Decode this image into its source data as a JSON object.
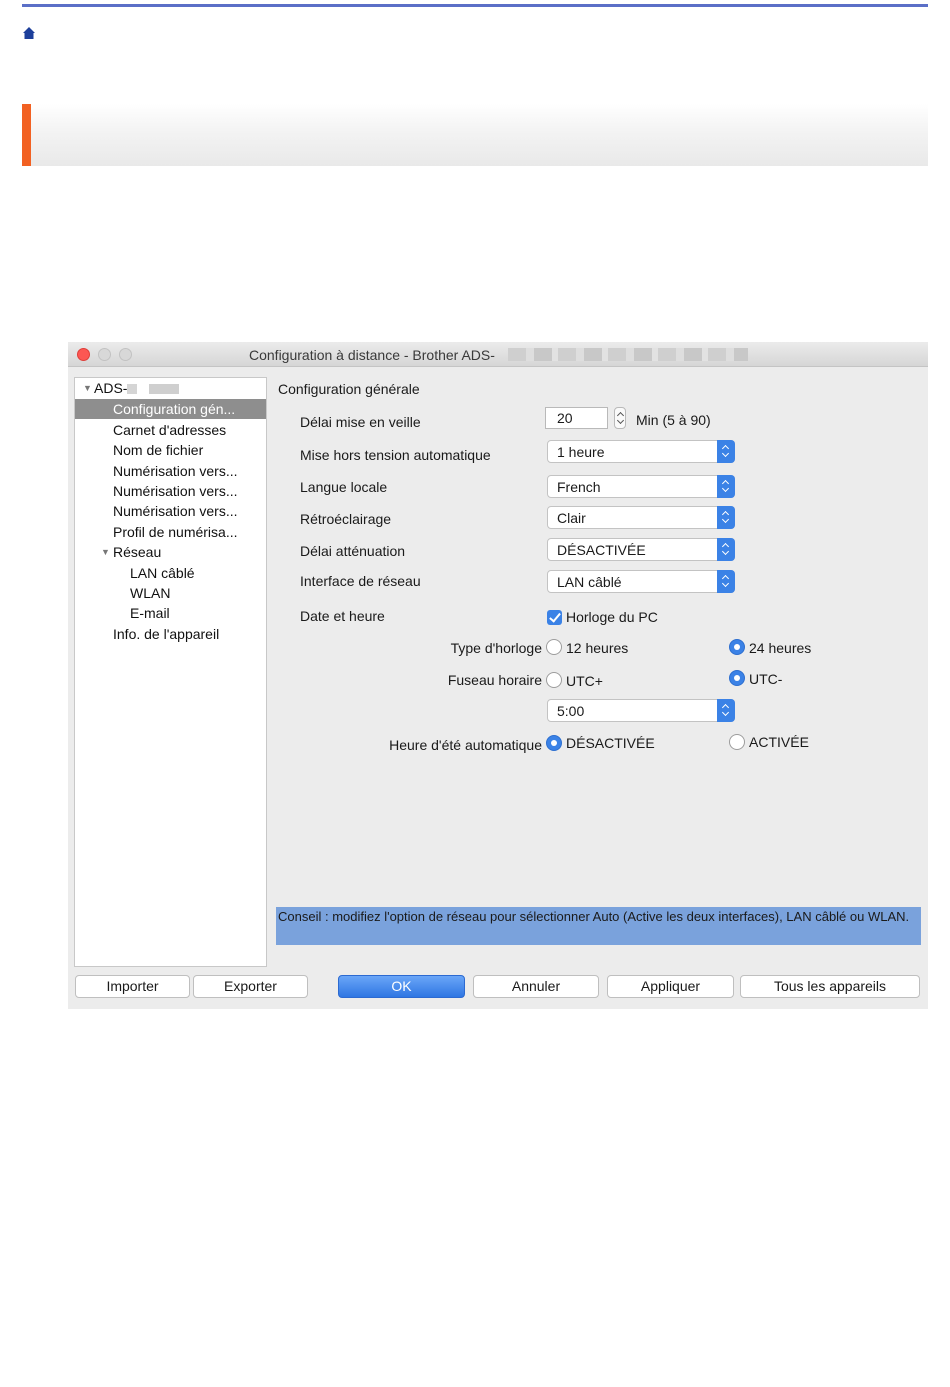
{
  "dialog": {
    "title": "Configuration à distance - Brother ADS-"
  },
  "sidebar": {
    "root": "ADS-",
    "items": [
      {
        "label": "Configuration gén..."
      },
      {
        "label": "Carnet d'adresses"
      },
      {
        "label": "Nom de fichier"
      },
      {
        "label": "Numérisation vers..."
      },
      {
        "label": "Numérisation vers..."
      },
      {
        "label": "Numérisation vers..."
      },
      {
        "label": "Profil de numérisa..."
      },
      {
        "label": "Réseau"
      },
      {
        "label": "LAN câblé"
      },
      {
        "label": "WLAN"
      },
      {
        "label": "E-mail"
      },
      {
        "label": "Info. de l'appareil"
      }
    ]
  },
  "main": {
    "section_title": "Configuration générale",
    "sleep_delay": {
      "label": "Délai mise en veille",
      "value": "20",
      "unit": "Min (5 à 90)"
    },
    "auto_power_off": {
      "label": "Mise hors tension automatique",
      "value": "1 heure"
    },
    "language": {
      "label": "Langue locale",
      "value": "French"
    },
    "backlight": {
      "label": "Rétroéclairage",
      "value": "Clair"
    },
    "dim_timer": {
      "label": "Délai atténuation",
      "value": "DÉSACTIVÉE"
    },
    "network_interface": {
      "label": "Interface de réseau",
      "value": "LAN câblé"
    },
    "date_time": {
      "label": "Date et heure",
      "pc_clock": "Horloge du PC",
      "pc_clock_checked": true
    },
    "clock_type": {
      "label": "Type d'horloge",
      "opt_12": "12 heures",
      "opt_24": "24 heures",
      "selected": "24 heures"
    },
    "time_zone": {
      "label": "Fuseau horaire",
      "opt_plus": "UTC+",
      "opt_minus": "UTC-",
      "selected": "UTC-",
      "offset": "5:00"
    },
    "dst": {
      "label": "Heure d'été automatique",
      "opt_off": "DÉSACTIVÉE",
      "opt_on": "ACTIVÉE",
      "selected": "DÉSACTIVÉE"
    },
    "tip": "Conseil : modifiez l'option de réseau pour sélectionner Auto (Active les deux interfaces), LAN câblé ou WLAN."
  },
  "buttons": {
    "import": "Importer",
    "export": "Exporter",
    "ok": "OK",
    "cancel": "Annuler",
    "apply": "Appliquer",
    "all_devices": "Tous les appareils"
  },
  "colors": {
    "accent": "#f26122",
    "rule": "#5b6fc7",
    "control_blue": "#3b82e6",
    "tip_bg": "#7aa2dc"
  }
}
